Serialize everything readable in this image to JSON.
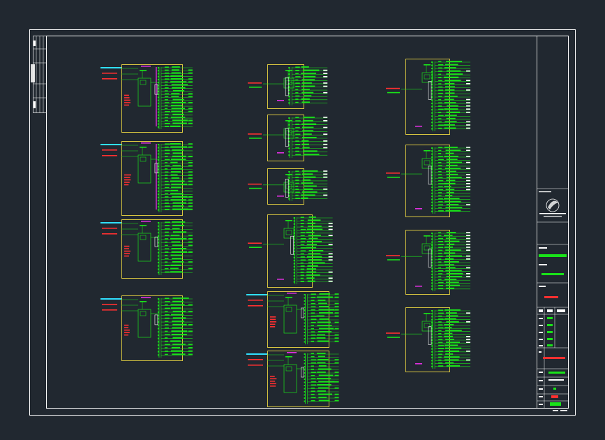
{
  "sheet": {
    "theme": {
      "background": "#212830",
      "border": "#ffffff",
      "frame": "#d8c640",
      "circuit": "#19e319",
      "feeder": "#ff3030",
      "tag": "#30e0ff",
      "bus": "#e030e0"
    }
  },
  "panels": [
    {
      "id": "p1",
      "group": "left"
    },
    {
      "id": "p2",
      "group": "left"
    },
    {
      "id": "p3",
      "group": "left"
    },
    {
      "id": "p4",
      "group": "left"
    },
    {
      "id": "p5",
      "group": "mid"
    },
    {
      "id": "p6",
      "group": "mid"
    },
    {
      "id": "p7",
      "group": "mid"
    },
    {
      "id": "p8",
      "group": "mid"
    },
    {
      "id": "p9",
      "group": "mid"
    },
    {
      "id": "p10",
      "group": "mid"
    },
    {
      "id": "p11",
      "group": "right"
    },
    {
      "id": "p12",
      "group": "right"
    },
    {
      "id": "p13",
      "group": "right"
    },
    {
      "id": "p14",
      "group": "right"
    }
  ],
  "title_block": {
    "logo": "company-logo-icon"
  }
}
